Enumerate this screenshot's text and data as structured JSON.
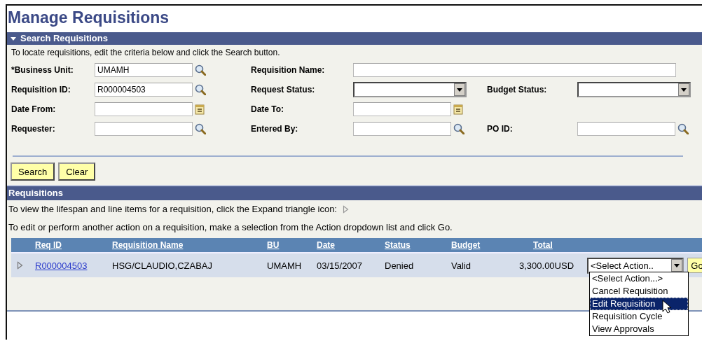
{
  "page_title": "Manage Requisitions",
  "search_section": {
    "title": "Search Requisitions",
    "expanded": true,
    "instructions": "To locate requisitions, edit the criteria below and click the Search button.",
    "rows": [
      [
        {
          "label": "*Business Unit:",
          "kind": "lookup",
          "value": "UMAMH"
        },
        {
          "label": "Requisition Name:",
          "kind": "text"
        }
      ],
      [
        {
          "label": "Requisition ID:",
          "kind": "lookup",
          "value": "R000004503"
        },
        {
          "label": "Request Status:",
          "kind": "select"
        },
        {
          "label": "Budget Status:",
          "kind": "select"
        }
      ],
      [
        {
          "label": "Date From:",
          "kind": "date"
        },
        {
          "label": "Date To:",
          "kind": "date"
        }
      ],
      [
        {
          "label": "Requester:",
          "kind": "lookup"
        },
        {
          "label": "Entered By:",
          "kind": "lookup"
        },
        {
          "label": "PO ID:",
          "kind": "lookup"
        }
      ]
    ],
    "buttons": [
      "Search",
      "Clear"
    ]
  },
  "requisitions": {
    "title": "Requisitions",
    "instructions": [
      "To view the lifespan and line items for a requisition, click the Expand triangle icon:",
      "To edit or perform another action on a requisition, make a selection from the Action dropdown list and click Go."
    ],
    "columns": [
      "Req ID",
      "Requisition Name",
      "BU",
      "Date",
      "Status",
      "Budget",
      "Total"
    ],
    "rows": [
      {
        "expanded": false,
        "req_id": "R000004503",
        "name": "HSG/CLAUDIO,CZABAJ",
        "bu": "UMAMH",
        "date": "03/15/2007",
        "status": "Denied",
        "budget": "Valid",
        "total": "3,300.00USD",
        "action": {
          "value": "<Select Action..",
          "open": true,
          "options": [
            {
              "label": "<Select Action...>",
              "selected": false
            },
            {
              "label": "Cancel Requisition",
              "selected": false
            },
            {
              "label": "Edit Requisition",
              "selected": true
            },
            {
              "label": "Requisition Cycle",
              "selected": false
            },
            {
              "label": "View Approvals",
              "selected": false
            }
          ]
        },
        "go_button": "Go"
      }
    ]
  }
}
